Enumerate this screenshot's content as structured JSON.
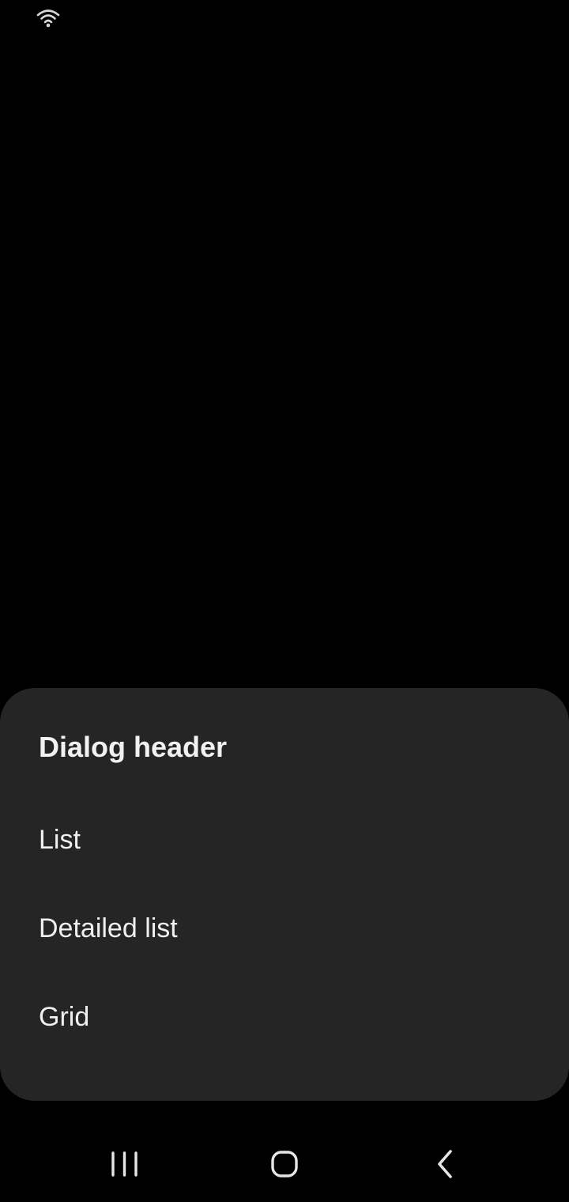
{
  "status_bar": {
    "icons": [
      "wifi-icon"
    ]
  },
  "dialog": {
    "header": "Dialog header",
    "options": [
      {
        "label": "List"
      },
      {
        "label": "Detailed list"
      },
      {
        "label": "Grid"
      }
    ]
  },
  "nav_bar": {
    "buttons": [
      "recents-icon",
      "home-icon",
      "back-icon"
    ]
  },
  "colors": {
    "background": "#000000",
    "dialog_surface": "#252525",
    "text": "#f0f0f0"
  }
}
